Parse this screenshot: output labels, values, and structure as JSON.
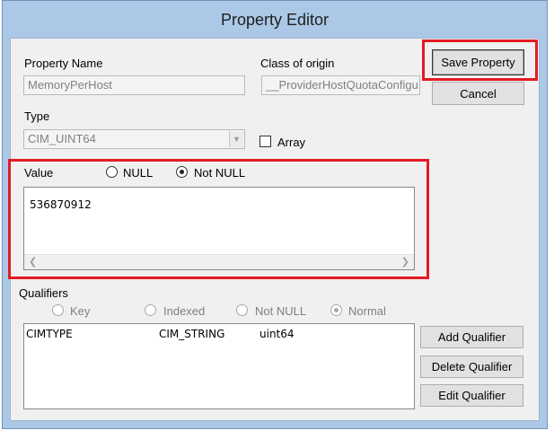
{
  "dialog": {
    "title": "Property Editor"
  },
  "fields": {
    "property_name_label": "Property Name",
    "property_name_value": "MemoryPerHost",
    "class_of_origin_label": "Class of origin",
    "class_of_origin_value": "__ProviderHostQuotaConfigu",
    "type_label": "Type",
    "type_value": "CIM_UINT64",
    "array_label": "Array",
    "array_checked": false
  },
  "value_section": {
    "label": "Value",
    "null_option": "NULL",
    "not_null_option": "Not NULL",
    "selected": "Not NULL",
    "value_text": "536870912"
  },
  "buttons": {
    "save": "Save Property",
    "cancel": "Cancel",
    "add_qualifier": "Add Qualifier",
    "delete_qualifier": "Delete Qualifier",
    "edit_qualifier": "Edit Qualifier"
  },
  "qualifiers": {
    "label": "Qualifiers",
    "flags": [
      "Key",
      "Indexed",
      "Not NULL",
      "Normal"
    ],
    "selected_flag": "Normal",
    "rows": [
      {
        "name": "CIMTYPE",
        "type": "CIM_STRING",
        "value": "uint64"
      }
    ]
  },
  "colors": {
    "highlight": "#e31b23",
    "title_bar": "#abc8e6",
    "dialog_body": "#f0f0f0"
  }
}
